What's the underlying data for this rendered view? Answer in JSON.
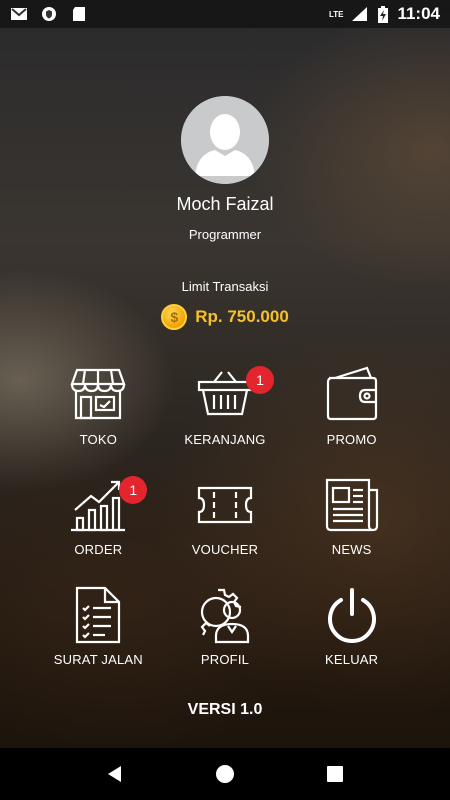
{
  "status_bar": {
    "time": "11:04",
    "network": "LTE",
    "left_icons": [
      "gmail-icon",
      "shield-icon",
      "sd-card-icon"
    ],
    "right_icons": [
      "signal-icon",
      "battery-charging-icon"
    ]
  },
  "profile": {
    "name": "Moch Faizal",
    "role": "Programmer",
    "avatar_icon": "person-avatar-icon"
  },
  "limit": {
    "label": "Limit Transaksi",
    "coin_symbol": "$",
    "value": "Rp. 750.000",
    "value_color": "#f5c02a"
  },
  "menu": [
    {
      "label": "TOKO",
      "icon": "store-icon",
      "badge": ""
    },
    {
      "label": "KERANJANG",
      "icon": "basket-icon",
      "badge": "1"
    },
    {
      "label": "PROMO",
      "icon": "wallet-icon",
      "badge": ""
    },
    {
      "label": "ORDER",
      "icon": "growth-chart-icon",
      "badge": "1"
    },
    {
      "label": "VOUCHER",
      "icon": "ticket-icon",
      "badge": ""
    },
    {
      "label": "NEWS",
      "icon": "newspaper-icon",
      "badge": ""
    },
    {
      "label": "SURAT JALAN",
      "icon": "checklist-document-icon",
      "badge": ""
    },
    {
      "label": "PROFIL",
      "icon": "profile-settings-icon",
      "badge": ""
    },
    {
      "label": "KELUAR",
      "icon": "power-icon",
      "badge": ""
    }
  ],
  "version": "VERSI 1.0",
  "nav": [
    "back-icon",
    "home-icon",
    "recents-icon"
  ],
  "colors": {
    "badge": "#e3262e",
    "accent_gold": "#f5c02a"
  }
}
